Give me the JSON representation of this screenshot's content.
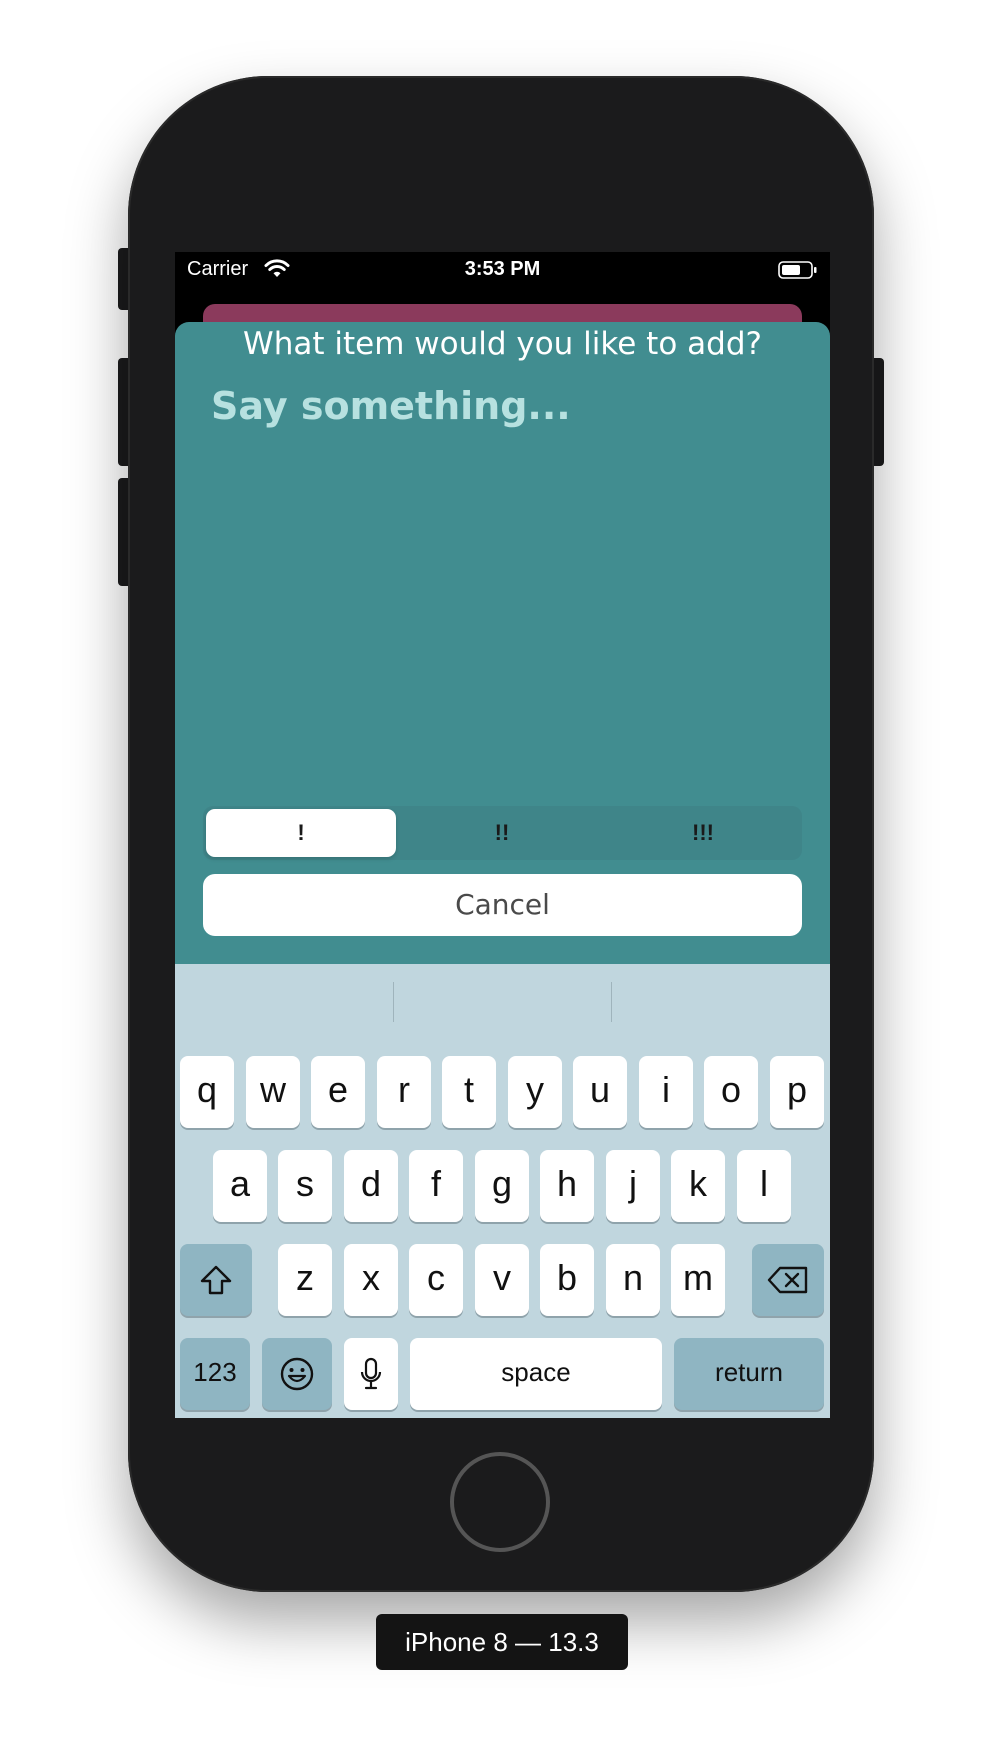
{
  "status_bar": {
    "carrier": "Carrier",
    "time": "3:53 PM",
    "wifi_icon": "wifi-icon",
    "battery_icon": "battery-icon"
  },
  "sheet": {
    "title": "What item would you like to add?",
    "text_placeholder": "Say something...",
    "priority_segments": [
      {
        "label": "!",
        "selected": true
      },
      {
        "label": "!!",
        "selected": false
      },
      {
        "label": "!!!",
        "selected": false
      }
    ],
    "cancel_label": "Cancel"
  },
  "keyboard": {
    "row1": [
      "q",
      "w",
      "e",
      "r",
      "t",
      "y",
      "u",
      "i",
      "o",
      "p"
    ],
    "row2": [
      "a",
      "s",
      "d",
      "f",
      "g",
      "h",
      "j",
      "k",
      "l"
    ],
    "row3": [
      "z",
      "x",
      "c",
      "v",
      "b",
      "n",
      "m"
    ],
    "numbers_label": "123",
    "space_label": "space",
    "return_label": "return",
    "shift_icon": "shift-icon",
    "delete_icon": "delete-icon",
    "emoji_icon": "emoji-icon",
    "mic_icon": "microphone-icon"
  },
  "device": {
    "label": "iPhone 8 — 13.3"
  },
  "colors": {
    "sheet_bg": "#418d90",
    "placeholder": "#b7e1e0",
    "behind_card": "#8b3a5c",
    "keyboard_bg": "#c0d6de",
    "function_key": "#8fb5c2"
  }
}
